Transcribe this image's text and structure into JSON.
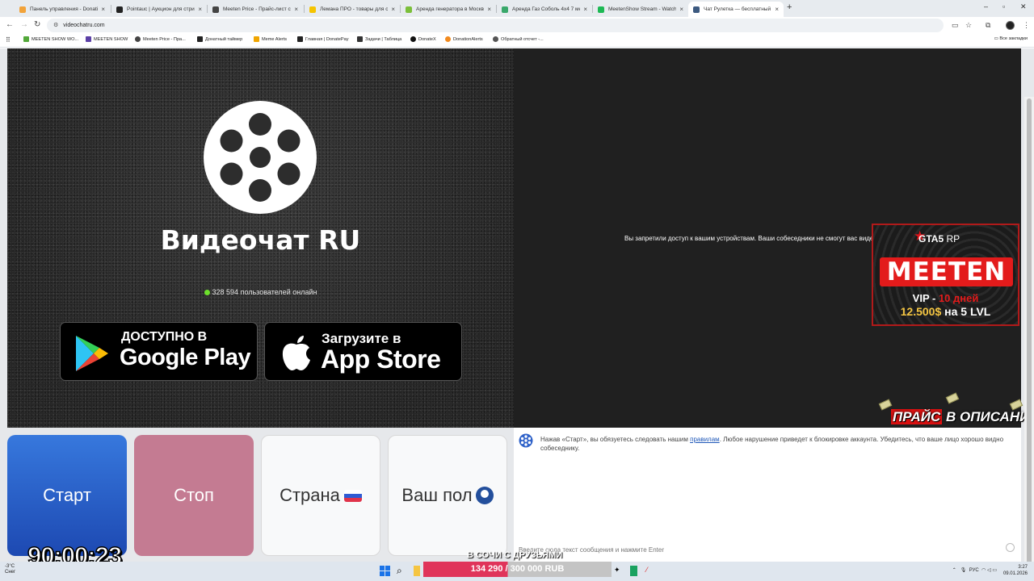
{
  "browser": {
    "tabs": [
      {
        "title": "Панель управления - Donatio",
        "color": "#f2a33a"
      },
      {
        "title": "Pointauc | Аукцион для стримо",
        "color": "#222222"
      },
      {
        "title": "Meeten Price - Прайс-лист стр",
        "color": "#444444"
      },
      {
        "title": "Лемана ПРО - товары для стр",
        "color": "#f5c400"
      },
      {
        "title": "Аренда генератора в Москве",
        "color": "#7bbf3a"
      },
      {
        "title": "Аренда Газ Соболь 4х4 7 мест",
        "color": "#3aa86b"
      },
      {
        "title": "MeetenShow Stream - Watch L",
        "color": "#1db954"
      },
      {
        "title": "Чат Рулетка — бесплатный ви",
        "color": "#3d5a80",
        "active": true
      }
    ],
    "url": "videochatru.com",
    "bookmarks": [
      {
        "label": "MEETEN SHOW WO...",
        "color": "#53a83a"
      },
      {
        "label": "MEETEN SHOW",
        "color": "#5b3fa6"
      },
      {
        "label": "Meeten Price - Пра...",
        "color": "#444444"
      },
      {
        "label": "Донатный таймер",
        "color": "#222222"
      },
      {
        "label": "Meme Alerts",
        "color": "#f0a500"
      },
      {
        "label": "Главная | DonatePay",
        "color": "#222222"
      },
      {
        "label": "Задачи | Таблица",
        "color": "#333333"
      },
      {
        "label": "DonateX",
        "color": "#111111"
      },
      {
        "label": "DonationAlerts",
        "color": "#f28a1e"
      },
      {
        "label": "Обратный отсчет -...",
        "color": "#555555"
      }
    ],
    "all_bookmarks": "Все закладки"
  },
  "left_panel": {
    "title": "Видеочат RU",
    "online_text": "328 594 пользователей онлайн",
    "google_play": {
      "line1": "ДОСТУПНО В",
      "line2": "Google Play"
    },
    "app_store": {
      "line1": "Загрузите в",
      "line2": "App Store"
    }
  },
  "right_panel": {
    "denied_text": "Вы запретили доступ к вашим устройствам. Ваши собеседники не смогут вас видет"
  },
  "promo": {
    "game": "GTA5",
    "game_suffix": "RP",
    "brand": "MEETEN",
    "vip_label": "VIP - ",
    "vip_days": "10 дней",
    "price": "12.500$",
    "level": "на 5 LVL"
  },
  "price_note": {
    "part1": "ПРАЙС",
    "part2": "В ОПИСАНИИ"
  },
  "controls": {
    "start": "Старт",
    "stop": "Стоп",
    "country": "Страна",
    "gender": "Ваш пол"
  },
  "chat": {
    "message_before": "Нажав «Старт», вы обязуетесь следовать нашим ",
    "rules_link": "правилам",
    "message_after": ". Любое нарушение приведет к блокировке аккаунта. Убедитесь, что ваше лицо хорошо видно собеседнику.",
    "input_placeholder": "Введите сюда текст сообщения и нажмите Enter"
  },
  "overlay": {
    "timer": "90:00:23",
    "sochi": "В СОЧИ С ДРУЗЬЯМИ",
    "goal_text": "134 290 / 300 000 RUB",
    "goal_progress": 0.4476
  },
  "taskbar": {
    "weather_temp": "-3°C",
    "weather_desc": "Снег",
    "lang": "РУС",
    "time": "3:27",
    "date": "09.01.2026"
  }
}
